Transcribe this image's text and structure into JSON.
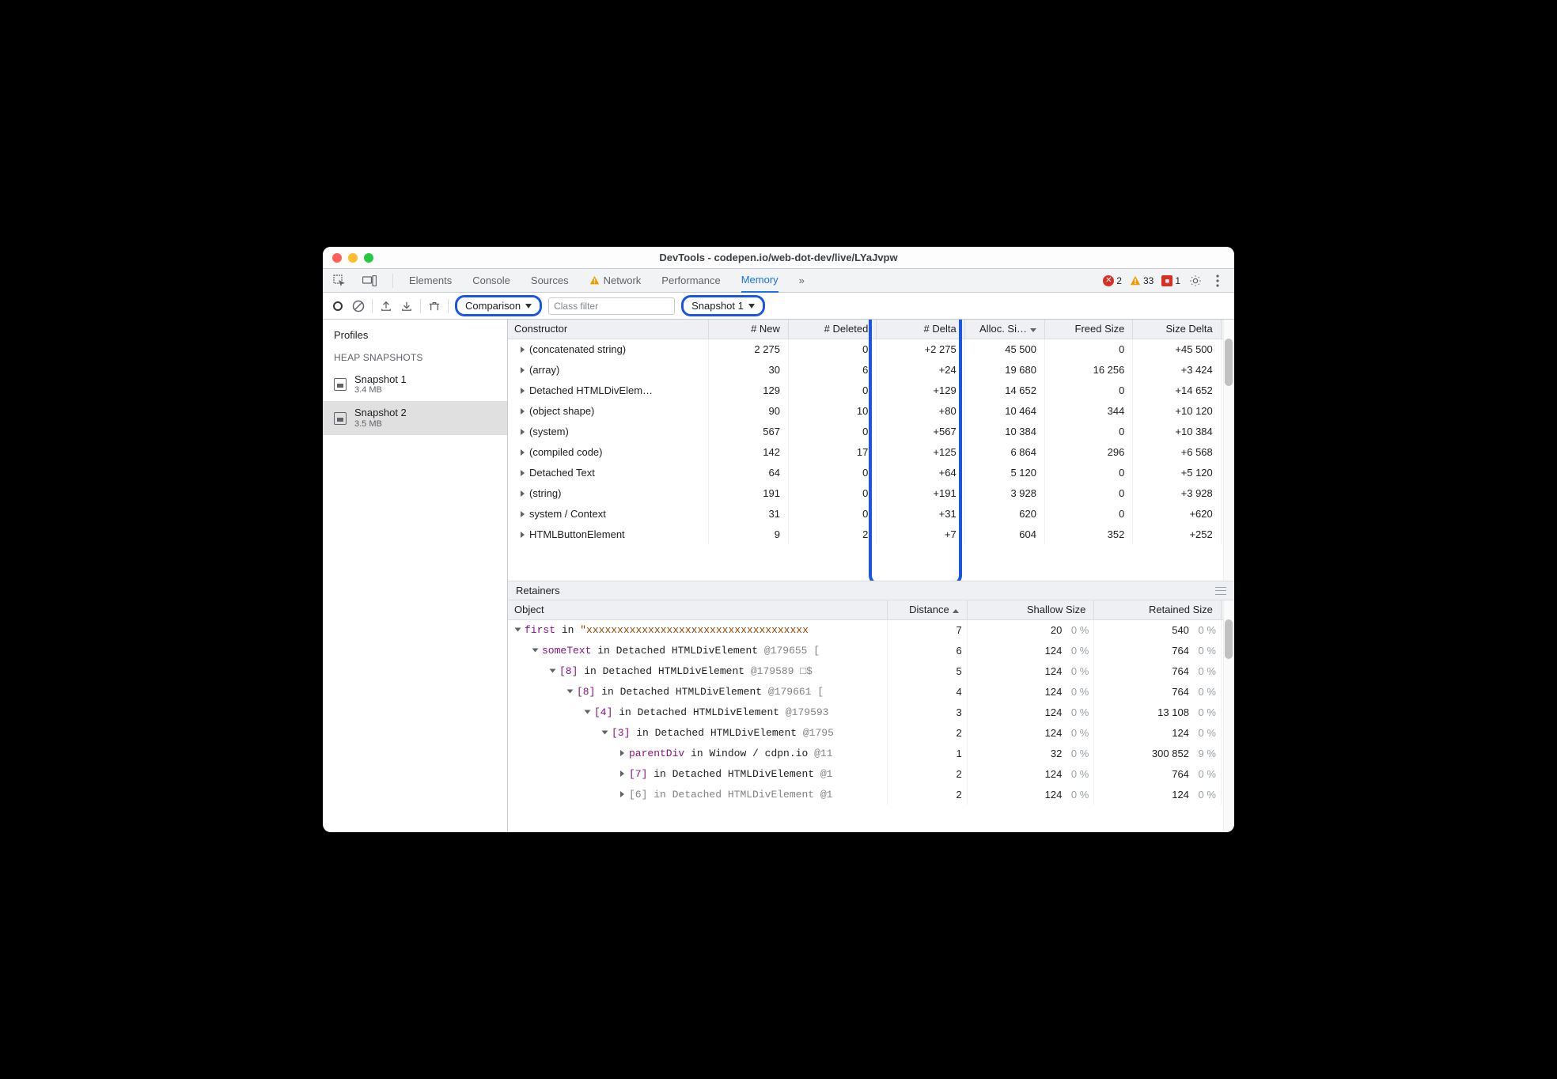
{
  "window": {
    "title": "DevTools - codepen.io/web-dot-dev/live/LYaJvpw"
  },
  "tabs": {
    "items": [
      "Elements",
      "Console",
      "Sources",
      "Network",
      "Performance",
      "Memory"
    ],
    "active": "Memory",
    "network_has_warning": true
  },
  "status": {
    "error_count": "2",
    "warning_count": "33",
    "info_count": "1"
  },
  "toolbar": {
    "view_mode": "Comparison",
    "class_filter_placeholder": "Class filter",
    "base_snapshot": "Snapshot 1"
  },
  "sidebar": {
    "title": "Profiles",
    "subhead": "HEAP SNAPSHOTS",
    "snapshots": [
      {
        "name": "Snapshot 1",
        "size": "3.4 MB"
      },
      {
        "name": "Snapshot 2",
        "size": "3.5 MB"
      }
    ],
    "active_index": 1
  },
  "comparison": {
    "columns": [
      "Constructor",
      "# New",
      "# Deleted",
      "# Delta",
      "Alloc. Si…",
      "Freed Size",
      "Size Delta"
    ],
    "sort_col": 4,
    "sort_dir": "desc",
    "rows": [
      {
        "constructor": "(concatenated string)",
        "new": "2 275",
        "deleted": "0",
        "delta": "+2 275",
        "alloc": "45 500",
        "freed": "0",
        "size_delta": "+45 500"
      },
      {
        "constructor": "(array)",
        "new": "30",
        "deleted": "6",
        "delta": "+24",
        "alloc": "19 680",
        "freed": "16 256",
        "size_delta": "+3 424"
      },
      {
        "constructor": "Detached HTMLDivElem…",
        "new": "129",
        "deleted": "0",
        "delta": "+129",
        "alloc": "14 652",
        "freed": "0",
        "size_delta": "+14 652"
      },
      {
        "constructor": "(object shape)",
        "new": "90",
        "deleted": "10",
        "delta": "+80",
        "alloc": "10 464",
        "freed": "344",
        "size_delta": "+10 120"
      },
      {
        "constructor": "(system)",
        "new": "567",
        "deleted": "0",
        "delta": "+567",
        "alloc": "10 384",
        "freed": "0",
        "size_delta": "+10 384"
      },
      {
        "constructor": "(compiled code)",
        "new": "142",
        "deleted": "17",
        "delta": "+125",
        "alloc": "6 864",
        "freed": "296",
        "size_delta": "+6 568"
      },
      {
        "constructor": "Detached Text",
        "new": "64",
        "deleted": "0",
        "delta": "+64",
        "alloc": "5 120",
        "freed": "0",
        "size_delta": "+5 120"
      },
      {
        "constructor": "(string)",
        "new": "191",
        "deleted": "0",
        "delta": "+191",
        "alloc": "3 928",
        "freed": "0",
        "size_delta": "+3 928"
      },
      {
        "constructor": "system / Context",
        "new": "31",
        "deleted": "0",
        "delta": "+31",
        "alloc": "620",
        "freed": "0",
        "size_delta": "+620"
      },
      {
        "constructor": "HTMLButtonElement",
        "new": "9",
        "deleted": "2",
        "delta": "+7",
        "alloc": "604",
        "freed": "352",
        "size_delta": "+252"
      }
    ]
  },
  "retainers": {
    "title": "Retainers",
    "columns": [
      "Object",
      "Distance",
      "Shallow Size",
      "Retained Size"
    ],
    "sort_col": 1,
    "sort_dir": "asc",
    "rows": [
      {
        "indent": 0,
        "open": true,
        "pre": "first",
        "pre_cls": "purple",
        "mid": " in ",
        "obj": "\"xxxxxxxxxxxxxxxxxxxxxxxxxxxxxxxxxxxx",
        "obj_cls": "orange",
        "tail": "",
        "distance": "7",
        "shallow": "20",
        "shallow_pct": "0 %",
        "retained": "540",
        "retained_pct": "0 %"
      },
      {
        "indent": 1,
        "open": true,
        "pre": "someText",
        "pre_cls": "purple",
        "mid": " in ",
        "obj": "Detached HTMLDivElement ",
        "obj_cls": "",
        "tail": "@179655 [",
        "distance": "6",
        "shallow": "124",
        "shallow_pct": "0 %",
        "retained": "764",
        "retained_pct": "0 %"
      },
      {
        "indent": 2,
        "open": true,
        "pre": "[8]",
        "pre_cls": "purple",
        "mid": " in ",
        "obj": "Detached HTMLDivElement ",
        "obj_cls": "",
        "tail": "@179589 □$",
        "distance": "5",
        "shallow": "124",
        "shallow_pct": "0 %",
        "retained": "764",
        "retained_pct": "0 %"
      },
      {
        "indent": 3,
        "open": true,
        "pre": "[8]",
        "pre_cls": "purple",
        "mid": " in ",
        "obj": "Detached HTMLDivElement ",
        "obj_cls": "",
        "tail": "@179661 [",
        "distance": "4",
        "shallow": "124",
        "shallow_pct": "0 %",
        "retained": "764",
        "retained_pct": "0 %"
      },
      {
        "indent": 4,
        "open": true,
        "pre": "[4]",
        "pre_cls": "purple",
        "mid": " in ",
        "obj": "Detached HTMLDivElement ",
        "obj_cls": "",
        "tail": "@179593",
        "distance": "3",
        "shallow": "124",
        "shallow_pct": "0 %",
        "retained": "13 108",
        "retained_pct": "0 %"
      },
      {
        "indent": 5,
        "open": true,
        "pre": "[3]",
        "pre_cls": "purple",
        "mid": " in ",
        "obj": "Detached HTMLDivElement ",
        "obj_cls": "",
        "tail": "@1795",
        "distance": "2",
        "shallow": "124",
        "shallow_pct": "0 %",
        "retained": "124",
        "retained_pct": "0 %"
      },
      {
        "indent": 6,
        "open": false,
        "pre": "parentDiv",
        "pre_cls": "purple",
        "mid": " in ",
        "obj": "Window / cdpn.io ",
        "obj_cls": "",
        "tail": "@11",
        "distance": "1",
        "shallow": "32",
        "shallow_pct": "0 %",
        "retained": "300 852",
        "retained_pct": "9 %"
      },
      {
        "indent": 6,
        "open": false,
        "pre": "[7]",
        "pre_cls": "purple",
        "mid": " in ",
        "obj": "Detached HTMLDivElement ",
        "obj_cls": "",
        "tail": "@1",
        "distance": "2",
        "shallow": "124",
        "shallow_pct": "0 %",
        "retained": "764",
        "retained_pct": "0 %"
      },
      {
        "indent": 6,
        "open": false,
        "pre": "[6]",
        "pre_cls": "grayc",
        "mid": " in ",
        "obj": "Detached HTMLDivElement ",
        "obj_cls": "grayc",
        "tail": "@1",
        "distance": "2",
        "shallow": "124",
        "shallow_pct": "0 %",
        "retained": "124",
        "retained_pct": "0 %"
      }
    ]
  }
}
